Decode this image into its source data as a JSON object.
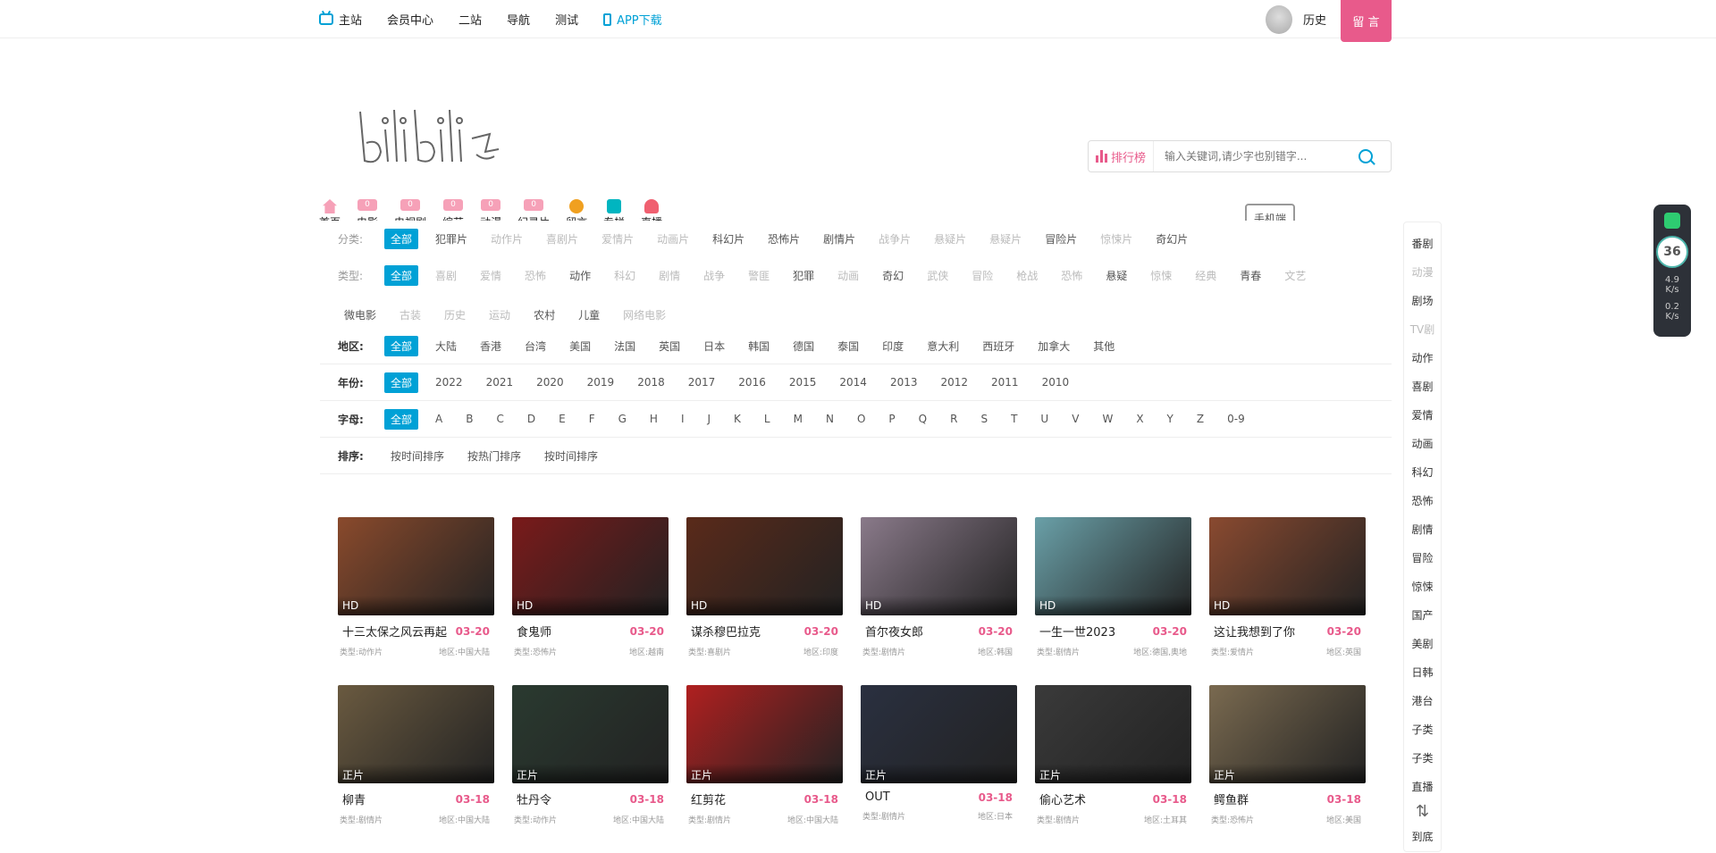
{
  "topbar": {
    "nav": [
      "主站",
      "会员中心",
      "二站",
      "导航",
      "测试"
    ],
    "app_download": "APP下载",
    "history": "历史",
    "message_button": "留 言"
  },
  "search": {
    "rank_label": "排行榜",
    "placeholder": "输入关键词,请少字也别错字..."
  },
  "categories": [
    {
      "label": "首页",
      "badge": ""
    },
    {
      "label": "电影",
      "badge": "0"
    },
    {
      "label": "电视剧",
      "badge": "0"
    },
    {
      "label": "综艺",
      "badge": "0"
    },
    {
      "label": "动漫",
      "badge": "0"
    },
    {
      "label": "纪录片",
      "badge": "0"
    },
    {
      "label": "留言",
      "badge": ""
    },
    {
      "label": "专栏",
      "badge": ""
    },
    {
      "label": "直播",
      "badge": ""
    }
  ],
  "mobile_label": "手机端",
  "filters": {
    "class_label": "分类:",
    "class_tags": [
      "全部",
      "犯罪片",
      "动作片",
      "喜剧片",
      "爱情片",
      "动画片",
      "科幻片",
      "恐怖片",
      "剧情片",
      "战争片",
      "悬疑片",
      "悬疑片",
      "冒险片",
      "惊悚片",
      "奇幻片"
    ],
    "type_label": "类型:",
    "type_tags": [
      "全部",
      "喜剧",
      "爱情",
      "恐怖",
      "动作",
      "科幻",
      "剧情",
      "战争",
      "警匪",
      "犯罪",
      "动画",
      "奇幻",
      "武侠",
      "冒险",
      "枪战",
      "恐怖",
      "悬疑",
      "惊悚",
      "经典",
      "青春",
      "文艺",
      "微电影",
      "古装",
      "历史",
      "运动",
      "农村",
      "儿童",
      "网络电影"
    ],
    "region_label": "地区:",
    "region_tags": [
      "全部",
      "大陆",
      "香港",
      "台湾",
      "美国",
      "法国",
      "英国",
      "日本",
      "韩国",
      "德国",
      "泰国",
      "印度",
      "意大利",
      "西班牙",
      "加拿大",
      "其他"
    ],
    "year_label": "年份:",
    "year_tags": [
      "全部",
      "2022",
      "2021",
      "2020",
      "2019",
      "2018",
      "2017",
      "2016",
      "2015",
      "2014",
      "2013",
      "2012",
      "2011",
      "2010"
    ],
    "letter_label": "字母:",
    "letter_tags": [
      "全部",
      "A",
      "B",
      "C",
      "D",
      "E",
      "F",
      "G",
      "H",
      "I",
      "J",
      "K",
      "L",
      "M",
      "N",
      "O",
      "P",
      "Q",
      "R",
      "S",
      "T",
      "U",
      "V",
      "W",
      "X",
      "Y",
      "Z",
      "0-9"
    ],
    "sort_label": "排序:",
    "sort_tags": [
      "按时间排序",
      "按热门排序",
      "按时间排序"
    ]
  },
  "movies": [
    {
      "title": "十三太保之风云再起",
      "date": "03-20",
      "quality": "HD",
      "type": "类型:动作片",
      "region": "地区:中国大陆",
      "color": "#8a4a2c"
    },
    {
      "title": "食鬼师",
      "date": "03-20",
      "quality": "HD",
      "type": "类型:恐怖片",
      "region": "地区:越南",
      "color": "#7a1a1a"
    },
    {
      "title": "谋杀穆巴拉克",
      "date": "03-20",
      "quality": "HD",
      "type": "类型:喜剧片",
      "region": "地区:印度",
      "color": "#5a2a1a"
    },
    {
      "title": "首尔夜女郎",
      "date": "03-20",
      "quality": "HD",
      "type": "类型:剧情片",
      "region": "地区:韩国",
      "color": "#8a7a8a"
    },
    {
      "title": "一生一世2023",
      "date": "03-20",
      "quality": "HD",
      "type": "类型:剧情片",
      "region": "地区:德国,奥地",
      "color": "#6aa0a8"
    },
    {
      "title": "这让我想到了你",
      "date": "03-20",
      "quality": "HD",
      "type": "类型:爱情片",
      "region": "地区:英国",
      "color": "#8a4a30"
    },
    {
      "title": "柳青",
      "date": "03-18",
      "quality": "正片",
      "type": "类型:剧情片",
      "region": "地区:中国大陆",
      "color": "#6a5a40"
    },
    {
      "title": "牡丹令",
      "date": "03-18",
      "quality": "正片",
      "type": "类型:动作片",
      "region": "地区:中国大陆",
      "color": "#2a3a30"
    },
    {
      "title": "红剪花",
      "date": "03-18",
      "quality": "正片",
      "type": "类型:剧情片",
      "region": "地区:中国大陆",
      "color": "#b02020"
    },
    {
      "title": "OUT",
      "date": "03-18",
      "quality": "正片",
      "type": "类型:剧情片",
      "region": "地区:日本",
      "color": "#2a3040"
    },
    {
      "title": "偷心艺术",
      "date": "03-18",
      "quality": "正片",
      "type": "类型:剧情片",
      "region": "地区:土耳其",
      "color": "#3a3a3a"
    },
    {
      "title": "鳄鱼群",
      "date": "03-18",
      "quality": "正片",
      "type": "类型:恐怖片",
      "region": "地区:美国",
      "color": "#7a6a50"
    }
  ],
  "sidebar": [
    "番剧",
    "动漫",
    "剧场",
    "TV剧",
    "动作",
    "喜剧",
    "爱情",
    "动画",
    "科幻",
    "恐怖",
    "剧情",
    "冒险",
    "惊悚",
    "国产",
    "美剧",
    "日韩",
    "港台",
    "子类",
    "子类",
    "直播",
    "到底"
  ],
  "netmon": {
    "value": "36",
    "up": "4.9",
    "down": "0.2",
    "unit": "K/s"
  },
  "accent": "#00a1d6",
  "pink": "#e85a8b"
}
